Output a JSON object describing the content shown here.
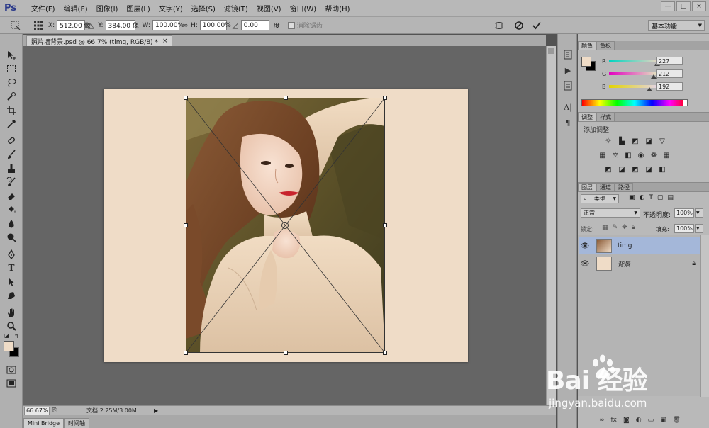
{
  "app": {
    "logo": "Ps",
    "menu": [
      "文件(F)",
      "编辑(E)",
      "图像(I)",
      "图层(L)",
      "文字(Y)",
      "选择(S)",
      "滤镜(T)",
      "视图(V)",
      "窗口(W)",
      "帮助(H)"
    ],
    "window_controls": [
      "—",
      "□",
      "×"
    ]
  },
  "options_bar": {
    "x_label": "X:",
    "x_value": "512.00 像",
    "y_label": "Y:",
    "y_value": "384.00 像",
    "w_label": "W:",
    "w_value": "100.00%",
    "h_label": "H:",
    "h_value": "100.00%",
    "angle_value": "0.00",
    "angle_unit": "度",
    "antialias_label": "消除锯齿",
    "workspace": "基本功能"
  },
  "document": {
    "tab_title": "照片墙背景.psd @ 66.7% (timg, RGB/8) *",
    "tab_close": "×",
    "canvas_color": "#efdcc7"
  },
  "status": {
    "zoom": "66.67%",
    "doc_info": "文档:2.25M/3.00M",
    "bottom_tabs": [
      "Mini Bridge",
      "时间轴"
    ]
  },
  "color_panel": {
    "tabs": [
      "颜色",
      "色板"
    ],
    "r_label": "R",
    "g_label": "G",
    "b_label": "B",
    "r": 227,
    "g": 212,
    "b": 192,
    "r_text": "227",
    "g_text": "212",
    "b_text": "192"
  },
  "adjustments_panel": {
    "tabs": [
      "调整",
      "样式"
    ],
    "title": "添加调整"
  },
  "layers_panel": {
    "tabs": [
      "图层",
      "通道",
      "路径"
    ],
    "filter_label": "类型",
    "blend_mode": "正常",
    "opacity_label": "不透明度:",
    "opacity_value": "100%",
    "lock_label": "锁定:",
    "fill_label": "填充:",
    "fill_value": "100%",
    "layers": [
      {
        "name": "timg",
        "selected": true
      },
      {
        "name": "背景",
        "selected": false,
        "locked": true
      }
    ]
  },
  "colors": {
    "foreground": "#efdcc7",
    "background": "#000000",
    "selected_layer": "#a4b7d9"
  },
  "watermark": {
    "brand": "Bai 经验",
    "url": "jingyan.baidu.com"
  }
}
